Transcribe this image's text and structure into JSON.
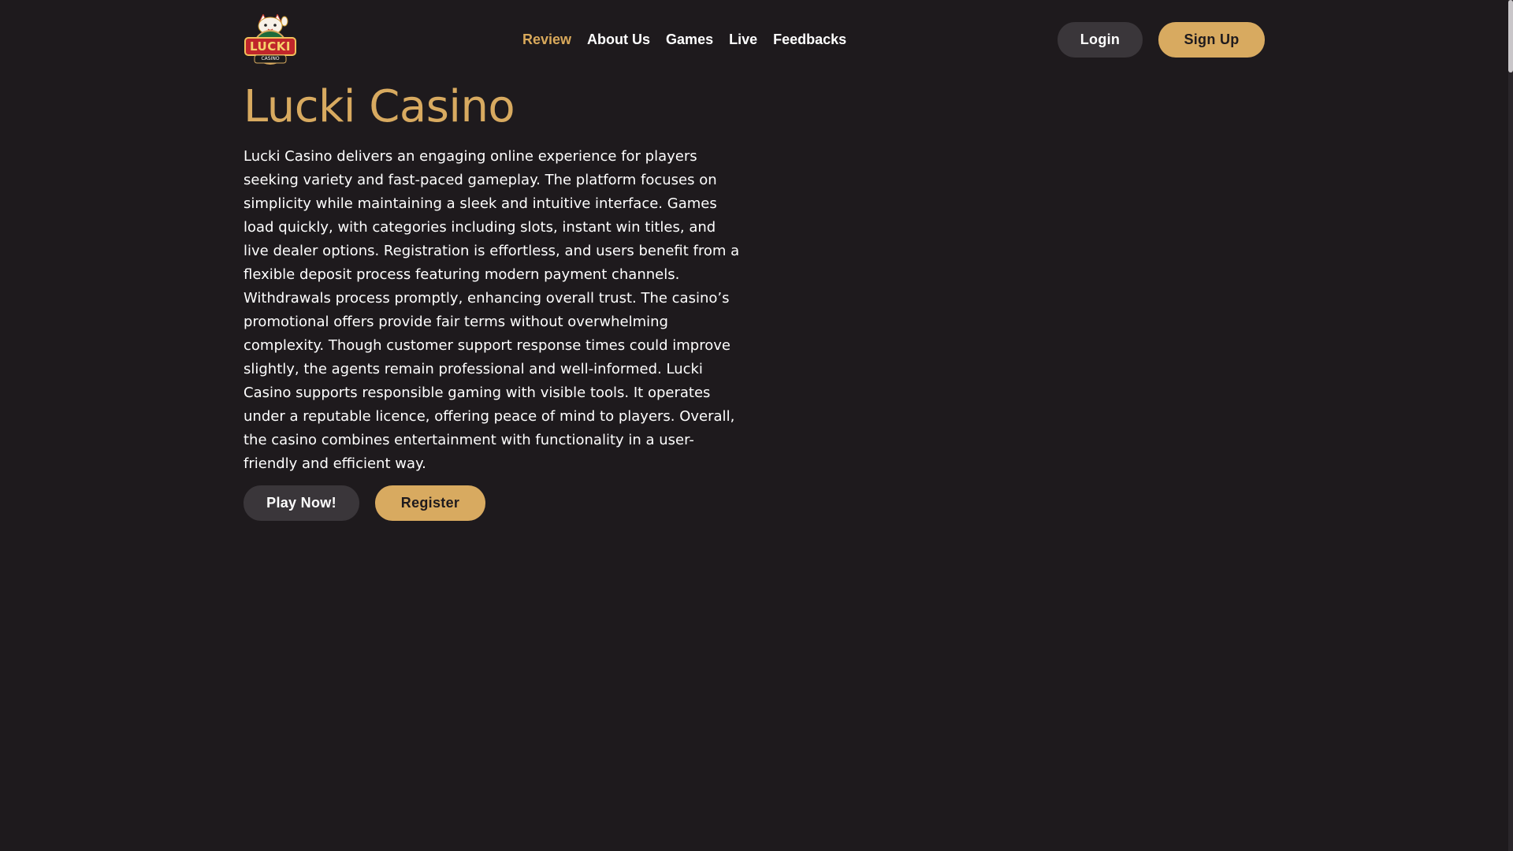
{
  "header": {
    "logo": {
      "text": "LUCKI",
      "subtext": "CASINO",
      "icon": "lucky-cat-logo-icon"
    },
    "nav": [
      {
        "label": "Review",
        "active": true
      },
      {
        "label": "About Us",
        "active": false
      },
      {
        "label": "Games",
        "active": false
      },
      {
        "label": "Live",
        "active": false
      },
      {
        "label": "Feedbacks",
        "active": false
      }
    ],
    "login_label": "Login",
    "signup_label": "Sign Up"
  },
  "main": {
    "title": "Lucki Casino",
    "description": "Lucki Casino delivers an engaging online experience for players seeking variety and fast-paced gameplay. The platform focuses on simplicity while maintaining a sleek and intuitive interface. Games load quickly, with categories including slots, instant win titles, and live dealer options. Registration is effortless, and users benefit from a flexible deposit process featuring modern payment channels. Withdrawals process promptly, enhancing overall trust. The casino’s promotional offers provide fair terms without overwhelming complexity. Though customer support response times could improve slightly, the agents remain professional and well-informed. Lucki Casino supports responsible gaming with visible tools. It operates under a reputable licence, offering peace of mind to players. Overall, the casino combines entertainment with functionality in a user-friendly and efficient way.",
    "play_label": "Play Now!",
    "register_label": "Register"
  },
  "colors": {
    "background": "#1e1a1d",
    "accent": "#d8aa60",
    "dark_button": "#3a363a",
    "text": "#ffffff"
  }
}
